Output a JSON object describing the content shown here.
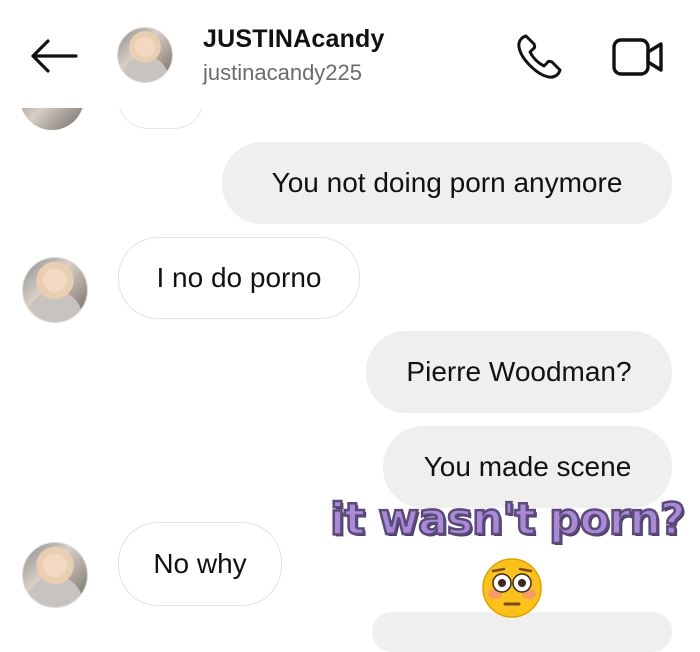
{
  "header": {
    "title": "JUSTINAcandy",
    "username": "justinacandy225",
    "icons": {
      "back": "arrow-left-icon",
      "call": "phone-icon",
      "video": "video-camera-icon"
    }
  },
  "messages": [
    {
      "direction": "sent",
      "text": "You not doing porn anymore"
    },
    {
      "direction": "received",
      "text": "I no do porno"
    },
    {
      "direction": "sent",
      "text": "Pierre Woodman?"
    },
    {
      "direction": "sent",
      "text": "You made scene"
    },
    {
      "direction": "received",
      "text": "No why"
    }
  ],
  "overlay": {
    "caption": "it wasn't porn?",
    "emoji": "flushed-face-emoji",
    "caption_color": "#a98ad6"
  }
}
